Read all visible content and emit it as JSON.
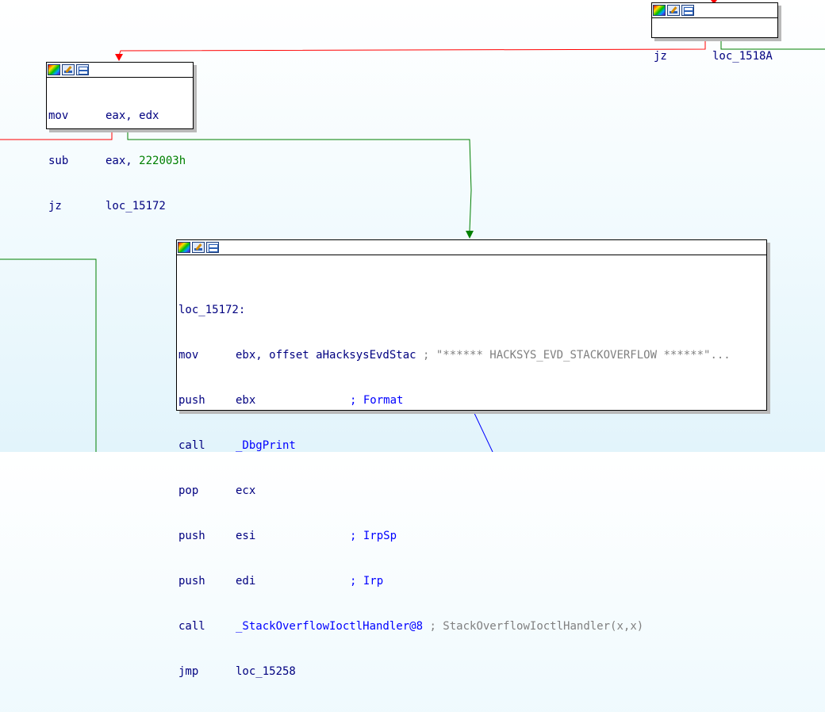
{
  "colors": {
    "edge_false": "#ff0000",
    "edge_true": "#008000",
    "edge_uncond": "#0000ff"
  },
  "icons": [
    "color-palette-icon",
    "rename-edit-icon",
    "graph-view-icon"
  ],
  "nodes": {
    "jz1518a": {
      "lines": [
        {
          "mnemonic": "jz",
          "operand": "loc_1518A"
        }
      ]
    },
    "sub222003": {
      "lines": [
        {
          "mnemonic": "mov",
          "op1": "eax,",
          "op2": "edx"
        },
        {
          "mnemonic": "sub",
          "op1": "eax,",
          "op2": "222003h"
        },
        {
          "mnemonic": "jz",
          "op1": "loc_15172"
        }
      ]
    },
    "loc15172": {
      "label": "loc_15172:",
      "lines": [
        {
          "mnemonic": "mov",
          "operand": "ebx, offset aHacksysEvdStac",
          "comment": "; \"****** HACKSYS_EVD_STACKOVERFLOW ******\"..."
        },
        {
          "mnemonic": "push",
          "operand": "ebx",
          "comment": "; Format"
        },
        {
          "mnemonic": "call",
          "operand": "_DbgPrint"
        },
        {
          "mnemonic": "pop",
          "operand": "ecx"
        },
        {
          "mnemonic": "push",
          "operand": "esi",
          "comment": "; IrpSp"
        },
        {
          "mnemonic": "push",
          "operand": "edi",
          "comment": "; Irp"
        },
        {
          "mnemonic": "call",
          "operand": "_StackOverflowIoctlHandler@8",
          "comment": "; StackOverflowIoctlHandler(x,x)"
        },
        {
          "mnemonic": "jmp",
          "operand": "loc_15258"
        }
      ]
    }
  }
}
